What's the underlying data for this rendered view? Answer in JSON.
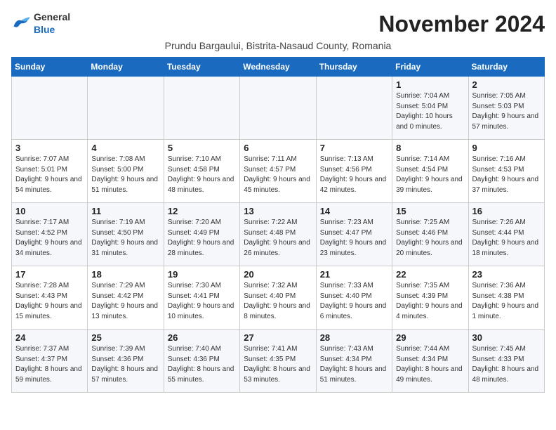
{
  "header": {
    "logo_general": "General",
    "logo_blue": "Blue",
    "month_title": "November 2024",
    "location": "Prundu Bargaului, Bistrita-Nasaud County, Romania"
  },
  "weekdays": [
    "Sunday",
    "Monday",
    "Tuesday",
    "Wednesday",
    "Thursday",
    "Friday",
    "Saturday"
  ],
  "weeks": [
    [
      {
        "day": "",
        "sunrise": "",
        "sunset": "",
        "daylight": ""
      },
      {
        "day": "",
        "sunrise": "",
        "sunset": "",
        "daylight": ""
      },
      {
        "day": "",
        "sunrise": "",
        "sunset": "",
        "daylight": ""
      },
      {
        "day": "",
        "sunrise": "",
        "sunset": "",
        "daylight": ""
      },
      {
        "day": "",
        "sunrise": "",
        "sunset": "",
        "daylight": ""
      },
      {
        "day": "1",
        "sunrise": "Sunrise: 7:04 AM",
        "sunset": "Sunset: 5:04 PM",
        "daylight": "Daylight: 10 hours and 0 minutes."
      },
      {
        "day": "2",
        "sunrise": "Sunrise: 7:05 AM",
        "sunset": "Sunset: 5:03 PM",
        "daylight": "Daylight: 9 hours and 57 minutes."
      }
    ],
    [
      {
        "day": "3",
        "sunrise": "Sunrise: 7:07 AM",
        "sunset": "Sunset: 5:01 PM",
        "daylight": "Daylight: 9 hours and 54 minutes."
      },
      {
        "day": "4",
        "sunrise": "Sunrise: 7:08 AM",
        "sunset": "Sunset: 5:00 PM",
        "daylight": "Daylight: 9 hours and 51 minutes."
      },
      {
        "day": "5",
        "sunrise": "Sunrise: 7:10 AM",
        "sunset": "Sunset: 4:58 PM",
        "daylight": "Daylight: 9 hours and 48 minutes."
      },
      {
        "day": "6",
        "sunrise": "Sunrise: 7:11 AM",
        "sunset": "Sunset: 4:57 PM",
        "daylight": "Daylight: 9 hours and 45 minutes."
      },
      {
        "day": "7",
        "sunrise": "Sunrise: 7:13 AM",
        "sunset": "Sunset: 4:56 PM",
        "daylight": "Daylight: 9 hours and 42 minutes."
      },
      {
        "day": "8",
        "sunrise": "Sunrise: 7:14 AM",
        "sunset": "Sunset: 4:54 PM",
        "daylight": "Daylight: 9 hours and 39 minutes."
      },
      {
        "day": "9",
        "sunrise": "Sunrise: 7:16 AM",
        "sunset": "Sunset: 4:53 PM",
        "daylight": "Daylight: 9 hours and 37 minutes."
      }
    ],
    [
      {
        "day": "10",
        "sunrise": "Sunrise: 7:17 AM",
        "sunset": "Sunset: 4:52 PM",
        "daylight": "Daylight: 9 hours and 34 minutes."
      },
      {
        "day": "11",
        "sunrise": "Sunrise: 7:19 AM",
        "sunset": "Sunset: 4:50 PM",
        "daylight": "Daylight: 9 hours and 31 minutes."
      },
      {
        "day": "12",
        "sunrise": "Sunrise: 7:20 AM",
        "sunset": "Sunset: 4:49 PM",
        "daylight": "Daylight: 9 hours and 28 minutes."
      },
      {
        "day": "13",
        "sunrise": "Sunrise: 7:22 AM",
        "sunset": "Sunset: 4:48 PM",
        "daylight": "Daylight: 9 hours and 26 minutes."
      },
      {
        "day": "14",
        "sunrise": "Sunrise: 7:23 AM",
        "sunset": "Sunset: 4:47 PM",
        "daylight": "Daylight: 9 hours and 23 minutes."
      },
      {
        "day": "15",
        "sunrise": "Sunrise: 7:25 AM",
        "sunset": "Sunset: 4:46 PM",
        "daylight": "Daylight: 9 hours and 20 minutes."
      },
      {
        "day": "16",
        "sunrise": "Sunrise: 7:26 AM",
        "sunset": "Sunset: 4:44 PM",
        "daylight": "Daylight: 9 hours and 18 minutes."
      }
    ],
    [
      {
        "day": "17",
        "sunrise": "Sunrise: 7:28 AM",
        "sunset": "Sunset: 4:43 PM",
        "daylight": "Daylight: 9 hours and 15 minutes."
      },
      {
        "day": "18",
        "sunrise": "Sunrise: 7:29 AM",
        "sunset": "Sunset: 4:42 PM",
        "daylight": "Daylight: 9 hours and 13 minutes."
      },
      {
        "day": "19",
        "sunrise": "Sunrise: 7:30 AM",
        "sunset": "Sunset: 4:41 PM",
        "daylight": "Daylight: 9 hours and 10 minutes."
      },
      {
        "day": "20",
        "sunrise": "Sunrise: 7:32 AM",
        "sunset": "Sunset: 4:40 PM",
        "daylight": "Daylight: 9 hours and 8 minutes."
      },
      {
        "day": "21",
        "sunrise": "Sunrise: 7:33 AM",
        "sunset": "Sunset: 4:40 PM",
        "daylight": "Daylight: 9 hours and 6 minutes."
      },
      {
        "day": "22",
        "sunrise": "Sunrise: 7:35 AM",
        "sunset": "Sunset: 4:39 PM",
        "daylight": "Daylight: 9 hours and 4 minutes."
      },
      {
        "day": "23",
        "sunrise": "Sunrise: 7:36 AM",
        "sunset": "Sunset: 4:38 PM",
        "daylight": "Daylight: 9 hours and 1 minute."
      }
    ],
    [
      {
        "day": "24",
        "sunrise": "Sunrise: 7:37 AM",
        "sunset": "Sunset: 4:37 PM",
        "daylight": "Daylight: 8 hours and 59 minutes."
      },
      {
        "day": "25",
        "sunrise": "Sunrise: 7:39 AM",
        "sunset": "Sunset: 4:36 PM",
        "daylight": "Daylight: 8 hours and 57 minutes."
      },
      {
        "day": "26",
        "sunrise": "Sunrise: 7:40 AM",
        "sunset": "Sunset: 4:36 PM",
        "daylight": "Daylight: 8 hours and 55 minutes."
      },
      {
        "day": "27",
        "sunrise": "Sunrise: 7:41 AM",
        "sunset": "Sunset: 4:35 PM",
        "daylight": "Daylight: 8 hours and 53 minutes."
      },
      {
        "day": "28",
        "sunrise": "Sunrise: 7:43 AM",
        "sunset": "Sunset: 4:34 PM",
        "daylight": "Daylight: 8 hours and 51 minutes."
      },
      {
        "day": "29",
        "sunrise": "Sunrise: 7:44 AM",
        "sunset": "Sunset: 4:34 PM",
        "daylight": "Daylight: 8 hours and 49 minutes."
      },
      {
        "day": "30",
        "sunrise": "Sunrise: 7:45 AM",
        "sunset": "Sunset: 4:33 PM",
        "daylight": "Daylight: 8 hours and 48 minutes."
      }
    ]
  ]
}
